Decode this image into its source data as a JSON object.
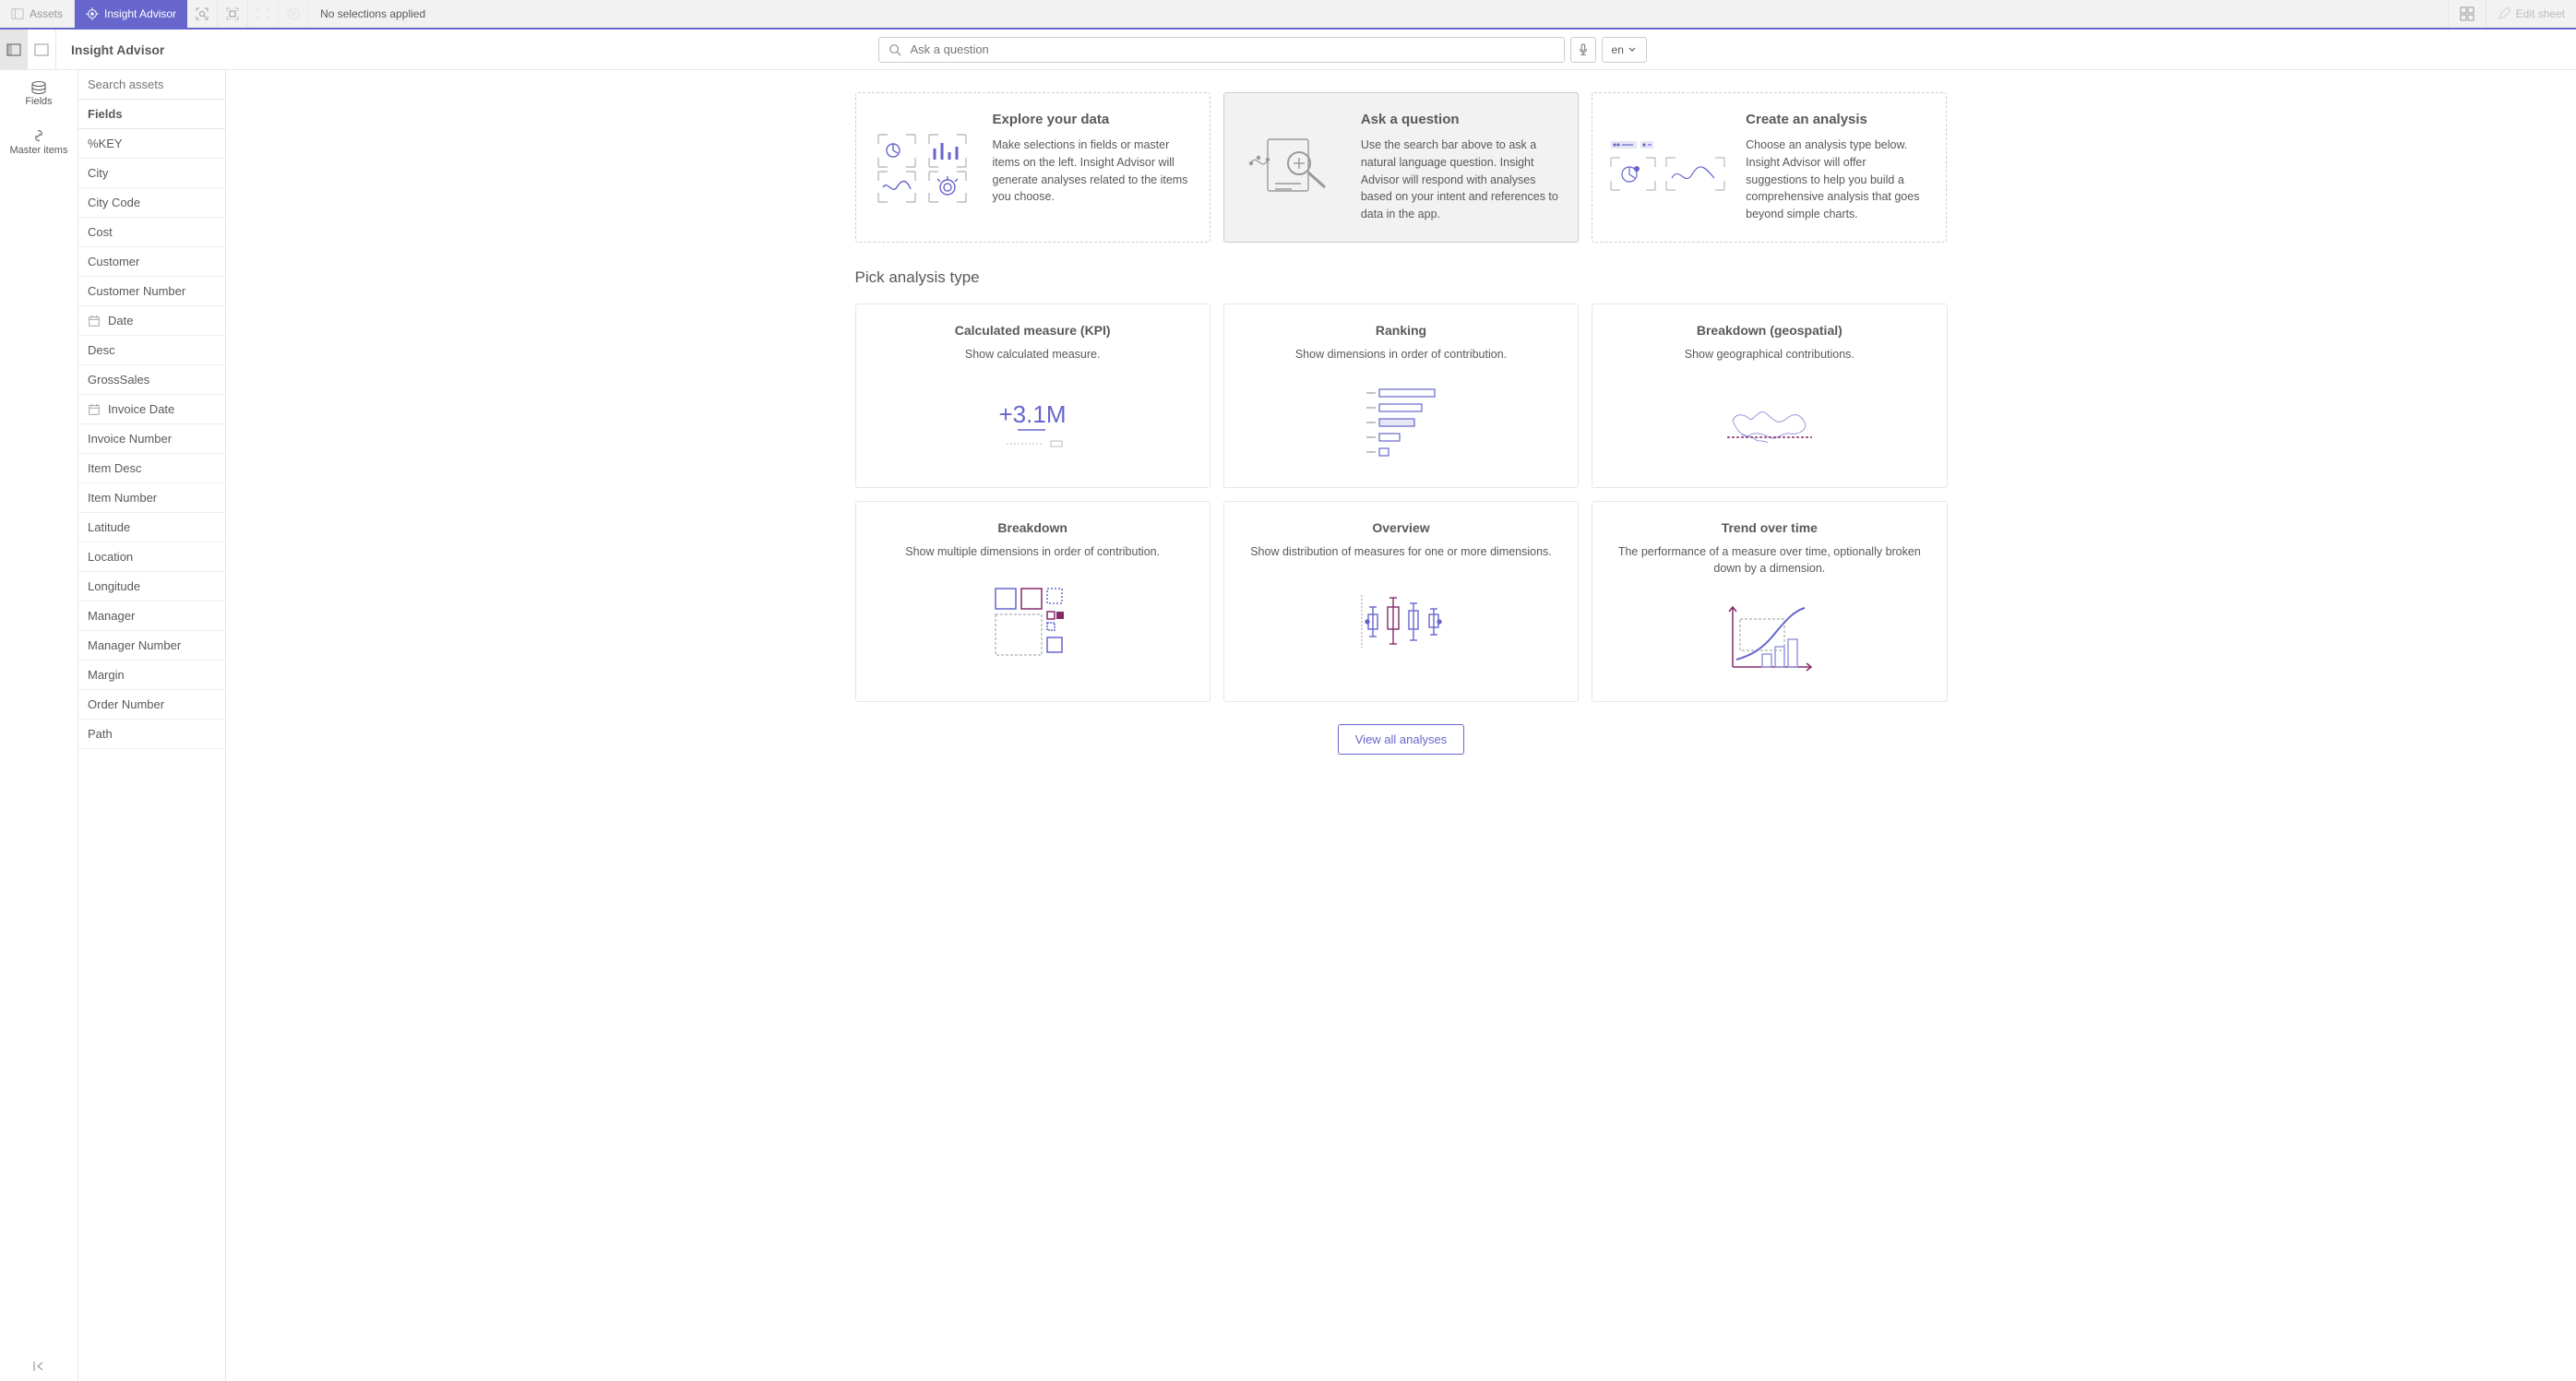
{
  "topbar": {
    "assets_label": "Assets",
    "insight_advisor_label": "Insight Advisor",
    "no_selections": "No selections applied",
    "edit_sheet_label": "Edit sheet"
  },
  "subbar": {
    "title": "Insight Advisor",
    "search_placeholder": "Ask a question",
    "lang": "en"
  },
  "rail": {
    "fields_label": "Fields",
    "master_label": "Master items"
  },
  "fields_panel": {
    "search_placeholder": "Search assets",
    "header": "Fields",
    "items": [
      {
        "label": "%KEY"
      },
      {
        "label": "City"
      },
      {
        "label": "City Code"
      },
      {
        "label": "Cost"
      },
      {
        "label": "Customer"
      },
      {
        "label": "Customer Number"
      },
      {
        "label": "Date",
        "calendar": true
      },
      {
        "label": "Desc"
      },
      {
        "label": "GrossSales"
      },
      {
        "label": "Invoice Date",
        "calendar": true
      },
      {
        "label": "Invoice Number"
      },
      {
        "label": "Item Desc"
      },
      {
        "label": "Item Number"
      },
      {
        "label": "Latitude"
      },
      {
        "label": "Location"
      },
      {
        "label": "Longitude"
      },
      {
        "label": "Manager"
      },
      {
        "label": "Manager Number"
      },
      {
        "label": "Margin"
      },
      {
        "label": "Order Number"
      },
      {
        "label": "Path"
      }
    ]
  },
  "top_cards": [
    {
      "title": "Explore your data",
      "desc": "Make selections in fields or master items on the left. Insight Advisor will generate analyses related to the items you choose."
    },
    {
      "title": "Ask a question",
      "desc": "Use the search bar above to ask a natural language question. Insight Advisor will respond with analyses based on your intent and references to data in the app."
    },
    {
      "title": "Create an analysis",
      "desc": "Choose an analysis type below. Insight Advisor will offer suggestions to help you build a comprehensive analysis that goes beyond simple charts."
    }
  ],
  "section_title": "Pick analysis type",
  "analyses": [
    {
      "title": "Calculated measure (KPI)",
      "desc": "Show calculated measure."
    },
    {
      "title": "Ranking",
      "desc": "Show dimensions in order of contribution."
    },
    {
      "title": "Breakdown (geospatial)",
      "desc": "Show geographical contributions."
    },
    {
      "title": "Breakdown",
      "desc": "Show multiple dimensions in order of contribution."
    },
    {
      "title": "Overview",
      "desc": "Show distribution of measures for one or more dimensions."
    },
    {
      "title": "Trend over time",
      "desc": "The performance of a measure over time, optionally broken down by a dimension."
    }
  ],
  "view_all": "View all analyses"
}
